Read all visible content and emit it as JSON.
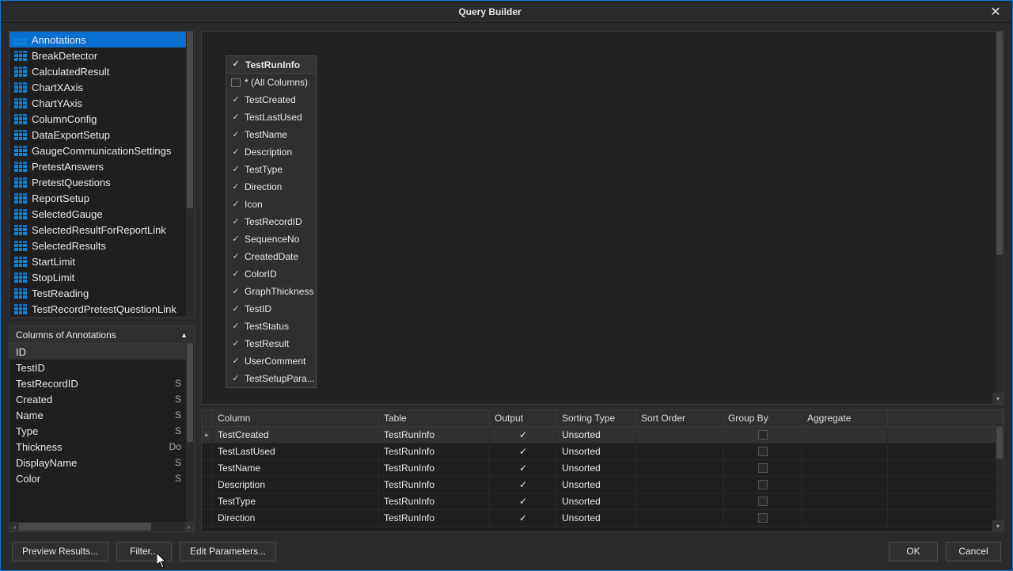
{
  "window": {
    "title": "Query Builder",
    "close_glyph": "✕"
  },
  "tables": [
    {
      "name": "Annotations",
      "selected": true
    },
    {
      "name": "BreakDetector"
    },
    {
      "name": "CalculatedResult"
    },
    {
      "name": "ChartXAxis"
    },
    {
      "name": "ChartYAxis"
    },
    {
      "name": "ColumnConfig"
    },
    {
      "name": "DataExportSetup"
    },
    {
      "name": "GaugeCommunicationSettings"
    },
    {
      "name": "PretestAnswers"
    },
    {
      "name": "PretestQuestions"
    },
    {
      "name": "ReportSetup"
    },
    {
      "name": "SelectedGauge"
    },
    {
      "name": "SelectedResultForReportLink"
    },
    {
      "name": "SelectedResults"
    },
    {
      "name": "StartLimit"
    },
    {
      "name": "StopLimit"
    },
    {
      "name": "TestReading"
    },
    {
      "name": "TestRecordPretestQuestionLink"
    }
  ],
  "columns_panel": {
    "title": "Columns of Annotations",
    "caret": "▲",
    "items": [
      {
        "name": "ID",
        "type": "",
        "selected": true
      },
      {
        "name": "TestID",
        "type": ""
      },
      {
        "name": "TestRecordID",
        "type": "S"
      },
      {
        "name": "Created",
        "type": "S"
      },
      {
        "name": "Name",
        "type": "S"
      },
      {
        "name": "Type",
        "type": "S"
      },
      {
        "name": "Thickness",
        "type": "Do"
      },
      {
        "name": "DisplayName",
        "type": "S"
      },
      {
        "name": "Color",
        "type": "S"
      }
    ]
  },
  "entity": {
    "title": "TestRunInfo",
    "all_columns_label": "* (All Columns)",
    "fields": [
      {
        "name": "TestCreated",
        "checked": true
      },
      {
        "name": "TestLastUsed",
        "checked": true
      },
      {
        "name": "TestName",
        "checked": true
      },
      {
        "name": "Description",
        "checked": true
      },
      {
        "name": "TestType",
        "checked": true
      },
      {
        "name": "Direction",
        "checked": true
      },
      {
        "name": "Icon",
        "checked": true
      },
      {
        "name": "TestRecordID",
        "checked": true
      },
      {
        "name": "SequenceNo",
        "checked": true
      },
      {
        "name": "CreatedDate",
        "checked": true
      },
      {
        "name": "ColorID",
        "checked": true
      },
      {
        "name": "GraphThickness",
        "checked": true
      },
      {
        "name": "TestID",
        "checked": true
      },
      {
        "name": "TestStatus",
        "checked": true
      },
      {
        "name": "TestResult",
        "checked": true
      },
      {
        "name": "UserComment",
        "checked": true
      },
      {
        "name": "TestSetupPara...",
        "checked": true
      }
    ]
  },
  "grid": {
    "headers": {
      "column": "Column",
      "table": "Table",
      "output": "Output",
      "sorting_type": "Sorting Type",
      "sort_order": "Sort Order",
      "group_by": "Group By",
      "aggregate": "Aggregate"
    },
    "rows": [
      {
        "column": "TestCreated",
        "table": "TestRunInfo",
        "output": true,
        "sorting": "Unsorted",
        "selected": true
      },
      {
        "column": "TestLastUsed",
        "table": "TestRunInfo",
        "output": true,
        "sorting": "Unsorted"
      },
      {
        "column": "TestName",
        "table": "TestRunInfo",
        "output": true,
        "sorting": "Unsorted"
      },
      {
        "column": "Description",
        "table": "TestRunInfo",
        "output": true,
        "sorting": "Unsorted"
      },
      {
        "column": "TestType",
        "table": "TestRunInfo",
        "output": true,
        "sorting": "Unsorted"
      },
      {
        "column": "Direction",
        "table": "TestRunInfo",
        "output": true,
        "sorting": "Unsorted"
      }
    ]
  },
  "footer": {
    "preview": "Preview Results...",
    "filter": "Filter...",
    "params": "Edit Parameters...",
    "ok": "OK",
    "cancel": "Cancel"
  }
}
